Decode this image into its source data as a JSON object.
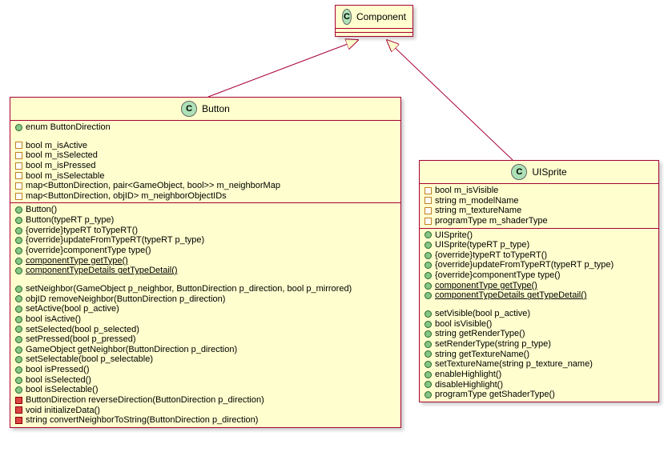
{
  "component": {
    "label": "Component",
    "stereotype": "C"
  },
  "button": {
    "label": "Button",
    "stereotype": "C",
    "enum": "enum ButtonDirection",
    "fields": [
      "bool m_isActive",
      "bool m_isSelected",
      "bool m_isPressed",
      "bool m_isSelectable",
      "map<ButtonDirection, pair<GameObject, bool>> m_neighborMap",
      "map<ButtonDirection, objID> m_neighborObjectIDs"
    ],
    "methods_a": [
      "Button()",
      "Button(typeRT p_type)",
      "{override}typeRT toTypeRT()",
      "{override}updateFromTypeRT(typeRT p_type)",
      "{override}componentType type()"
    ],
    "methods_a_static": [
      "componentType getType()",
      "componentTypeDetails getTypeDetail()"
    ],
    "methods_b": [
      "setNeighbor(GameObject p_neighbor, ButtonDirection p_direction, bool p_mirrored)",
      "objID removeNeighbor(ButtonDirection p_direction)",
      "setActive(bool p_active)",
      "bool isActive()",
      "setSelected(bool p_selected)",
      "setPressed(bool p_pressed)",
      "GameObject getNeighbor(ButtonDirection p_direction)",
      "setSelectable(bool p_selectable)",
      "bool isPressed()",
      "bool isSelected()",
      "bool isSelectable()"
    ],
    "methods_priv": [
      "ButtonDirection reverseDirection(ButtonDirection p_direction)",
      "void initializeData()",
      "string convertNeighborToString(ButtonDirection p_direction)"
    ]
  },
  "uisprite": {
    "label": "UISprite",
    "stereotype": "C",
    "fields": [
      "bool m_isVisible",
      "string m_modelName",
      "string m_textureName",
      "programType m_shaderType"
    ],
    "methods_a": [
      "UISprite()",
      "UISprite(typeRT p_type)",
      "{override}typeRT toTypeRT()",
      "{override}updateFromTypeRT(typeRT p_type)",
      "{override}componentType type()"
    ],
    "methods_a_static": [
      "componentType getType()",
      "componentTypeDetails getTypeDetail()"
    ],
    "methods_b": [
      "setVisible(bool p_active)",
      "bool isVisible()",
      "string getRenderType()",
      "setRenderType(string p_type)",
      "string getTextureName()",
      "setTextureName(string p_texture_name)",
      "enableHighlight()",
      "disableHighlight()",
      "programType getShaderType()"
    ]
  }
}
